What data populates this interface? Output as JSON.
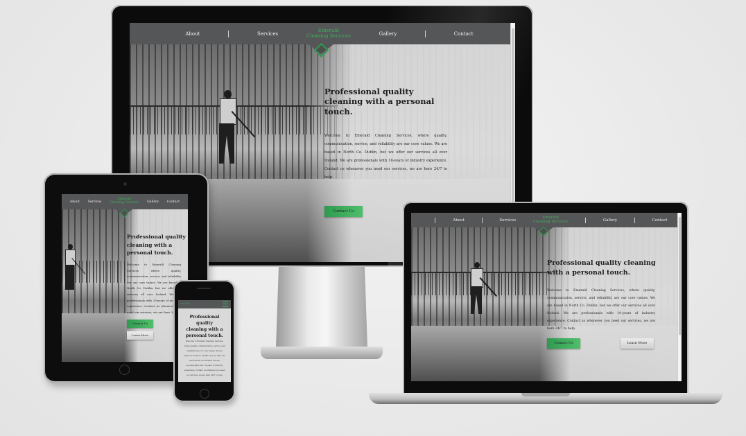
{
  "site": {
    "nav": {
      "about": "About",
      "services": "Services",
      "brand_line1": "Emerald",
      "brand_line2": "Cleaning Services",
      "gallery": "Gallery",
      "contact": "Contact"
    },
    "hero": {
      "title_desktop": "Professional quality cleaning with a personal touch.",
      "title_tablet_l1": "Professional quality",
      "title_tablet_l2": "cleaning with a",
      "title_tablet_l3": "personal touch.",
      "title_phone_l1": "Professional quality",
      "title_phone_l2": "cleaning with a",
      "title_phone_l3": "personal touch.",
      "body_desktop": "Welcome to Emerald Cleaning Services, where quality, communication, service, and reliability are our core values. We are based in North Co. Dublin, but we offer our services all over Ireland. We are professionals with 10-years of industry experience. Contact us whenever you need our services, we are here 24/7 to help.",
      "body_tablet": "Welcome to Emerald Cleaning Services, where quality, communication, service, and reliability are our core values. We are based in North Co. Dublin, but we offer our services all over Ireland. We are professionals with 10-years of industry experience. Contact us whenever you need our services, we are here 24/7 to help.",
      "body_phone": "Welcome to Emerald Cleaning Services, where quality, communication, service, and reliability are our core values. We are based in North Co. Dublin, but we offer our services all over Ireland. We are professionals with 10-years of industry experience. Contact us whenever you need our services, we are here 24/7 to help."
    },
    "buttons": {
      "contact_us": "Contact Us",
      "learn_more": "Learn More"
    }
  },
  "colors": {
    "nav_bg": "#555657",
    "brand_green": "#3fae5e",
    "button_green": "#2f9a4f"
  },
  "icons": [
    "diamond-logo-icon",
    "hamburger-menu-icon",
    "home-button-icon"
  ]
}
